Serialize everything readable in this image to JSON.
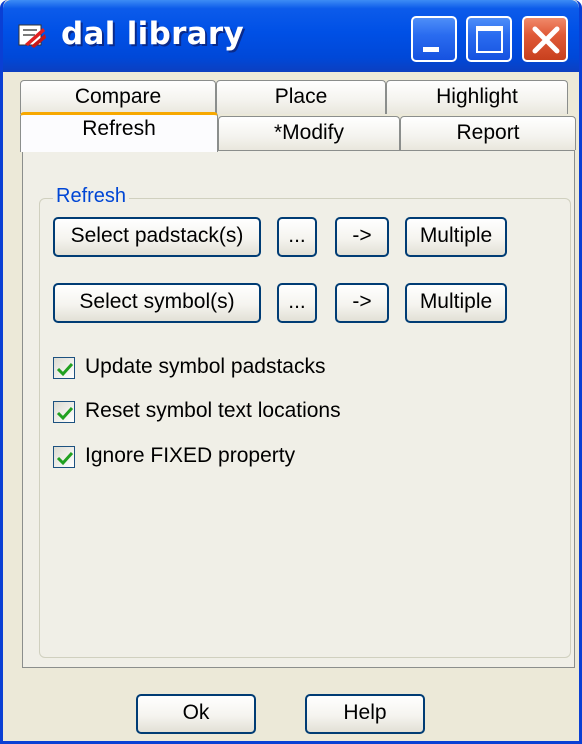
{
  "window": {
    "title": "dal library",
    "colors": {
      "titlebar": "#0050e6",
      "accent_tab": "#f7a800",
      "group_label": "#0046d5"
    }
  },
  "title_buttons": {
    "minimize_icon": "minimize-icon",
    "maximize_icon": "maximize-icon",
    "close_icon": "close-icon"
  },
  "tabs": {
    "row_back": [
      "Compare",
      "Place",
      "Highlight"
    ],
    "row_front": [
      "Refresh",
      "*Modify",
      "Report"
    ],
    "active": "Refresh"
  },
  "refresh_group": {
    "label": "Refresh",
    "padstack": {
      "select_label": "Select padstack(s)",
      "browse_label": "...",
      "arrow_label": "->",
      "multiple_label": "Multiple"
    },
    "symbol": {
      "select_label": "Select symbol(s)",
      "browse_label": "...",
      "arrow_label": "->",
      "multiple_label": "Multiple"
    },
    "options": [
      {
        "label": "Update symbol padstacks",
        "checked": true
      },
      {
        "label": "Reset symbol text locations",
        "checked": true
      },
      {
        "label": "Ignore FIXED property",
        "checked": true
      }
    ]
  },
  "footer": {
    "ok_label": "Ok",
    "help_label": "Help"
  }
}
